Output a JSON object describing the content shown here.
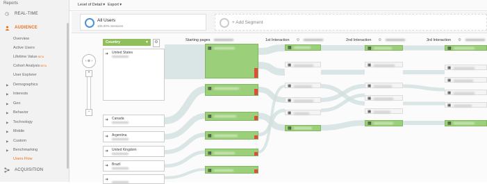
{
  "sidebar": {
    "reports_label": "Reports",
    "realtime_label": "REAL-TIME",
    "audience_label": "AUDIENCE",
    "acquisition_label": "ACQUISITION",
    "items": [
      {
        "label": "Overview"
      },
      {
        "label": "Active Users"
      },
      {
        "label": "Lifetime Value",
        "badge": "BETA"
      },
      {
        "label": "Cohort Analysis",
        "badge": "BETA"
      },
      {
        "label": "User Explorer"
      },
      {
        "label": "Demographics",
        "expandable": true
      },
      {
        "label": "Interests",
        "expandable": true
      },
      {
        "label": "Geo",
        "expandable": true
      },
      {
        "label": "Behavior",
        "expandable": true
      },
      {
        "label": "Technology",
        "expandable": true
      },
      {
        "label": "Mobile",
        "expandable": true
      },
      {
        "label": "Custom",
        "expandable": true
      },
      {
        "label": "Benchmarking",
        "expandable": true
      },
      {
        "label": "Users Flow",
        "selected": true
      }
    ],
    "accent_color": "#e8711a"
  },
  "toolbar": {
    "level_of_detail": "Level of Detail ▾",
    "export": "Export ▾"
  },
  "segments": {
    "all_users_title": "All Users",
    "all_users_sub": "100.00% Sessions",
    "add_segment": "+ Add Segment"
  },
  "flow": {
    "dimension_select": "Country",
    "countries": [
      "United States",
      "Canada",
      "Argentina",
      "United Kingdom",
      "Brazil",
      ""
    ],
    "columns": [
      "Starting pages",
      "1st Interaction",
      "2nd Interaction",
      "3rd Interaction"
    ],
    "node_color": "#9bcf7a",
    "dropoff_color": "#e14b3b"
  }
}
